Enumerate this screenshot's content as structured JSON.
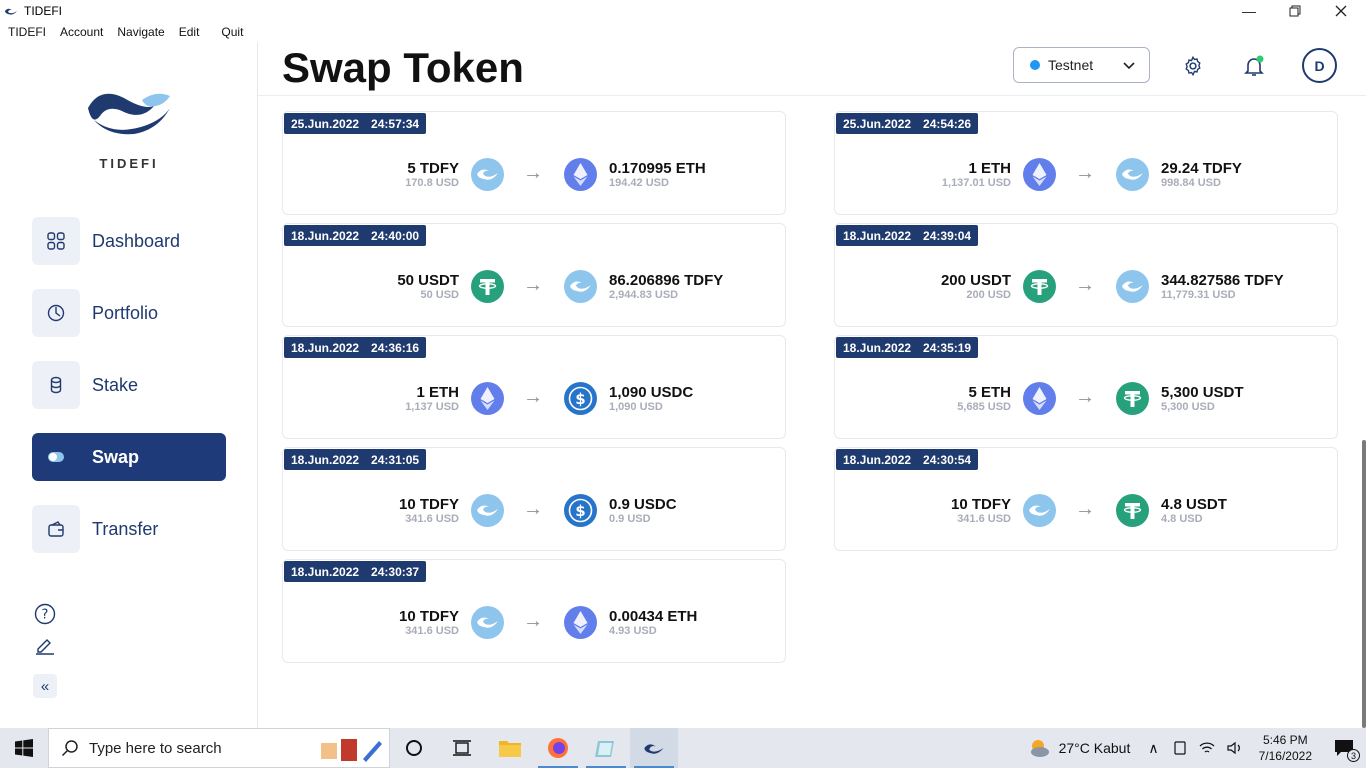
{
  "window": {
    "title": "TIDEFI"
  },
  "menu": [
    "TIDEFI",
    "Account",
    "Navigate",
    "Edit",
    "Quit"
  ],
  "brand": {
    "name": "TIDEFI"
  },
  "nav": [
    {
      "label": "Dashboard",
      "icon": "grid-icon"
    },
    {
      "label": "Portfolio",
      "icon": "pie-chart-icon"
    },
    {
      "label": "Stake",
      "icon": "coins-icon"
    },
    {
      "label": "Swap",
      "icon": "toggle-icon",
      "active": true
    },
    {
      "label": "Transfer",
      "icon": "wallet-icon"
    }
  ],
  "header": {
    "title": "Swap Token",
    "network": "Testnet",
    "avatar_initial": "D"
  },
  "swaps": [
    {
      "date": "25.Jun.2022",
      "time": "24:57:34",
      "from_amount": "5 TDFY",
      "from_usd": "170.8 USD",
      "from_token": "tdfy",
      "to_amount": "0.170995 ETH",
      "to_usd": "194.42 USD",
      "to_token": "eth"
    },
    {
      "date": "25.Jun.2022",
      "time": "24:54:26",
      "from_amount": "1 ETH",
      "from_usd": "1,137.01 USD",
      "from_token": "eth",
      "to_amount": "29.24 TDFY",
      "to_usd": "998.84 USD",
      "to_token": "tdfy"
    },
    {
      "date": "18.Jun.2022",
      "time": "24:40:00",
      "from_amount": "50 USDT",
      "from_usd": "50 USD",
      "from_token": "usdt",
      "to_amount": "86.206896 TDFY",
      "to_usd": "2,944.83 USD",
      "to_token": "tdfy"
    },
    {
      "date": "18.Jun.2022",
      "time": "24:39:04",
      "from_amount": "200 USDT",
      "from_usd": "200 USD",
      "from_token": "usdt",
      "to_amount": "344.827586 TDFY",
      "to_usd": "11,779.31 USD",
      "to_token": "tdfy"
    },
    {
      "date": "18.Jun.2022",
      "time": "24:36:16",
      "from_amount": "1 ETH",
      "from_usd": "1,137 USD",
      "from_token": "eth",
      "to_amount": "1,090 USDC",
      "to_usd": "1,090 USD",
      "to_token": "usdc"
    },
    {
      "date": "18.Jun.2022",
      "time": "24:35:19",
      "from_amount": "5 ETH",
      "from_usd": "5,685 USD",
      "from_token": "eth",
      "to_amount": "5,300 USDT",
      "to_usd": "5,300 USD",
      "to_token": "usdt"
    },
    {
      "date": "18.Jun.2022",
      "time": "24:31:05",
      "from_amount": "10 TDFY",
      "from_usd": "341.6 USD",
      "from_token": "tdfy",
      "to_amount": "0.9 USDC",
      "to_usd": "0.9 USD",
      "to_token": "usdc"
    },
    {
      "date": "18.Jun.2022",
      "time": "24:30:54",
      "from_amount": "10 TDFY",
      "from_usd": "341.6 USD",
      "from_token": "tdfy",
      "to_amount": "4.8 USDT",
      "to_usd": "4.8 USD",
      "to_token": "usdt"
    },
    {
      "date": "18.Jun.2022",
      "time": "24:30:37",
      "from_amount": "10 TDFY",
      "from_usd": "341.6 USD",
      "from_token": "tdfy",
      "to_amount": "0.00434 ETH",
      "to_usd": "4.93 USD",
      "to_token": "eth"
    }
  ],
  "taskbar": {
    "search_placeholder": "Type here to search",
    "weather": "27°C  Kabut",
    "time": "5:46 PM",
    "date": "7/16/2022",
    "notifications": "3"
  },
  "colors": {
    "primary": "#1f3a6e",
    "tdfy": "#8ec5ec",
    "eth": "#627eea",
    "usdt": "#26a17b",
    "usdc": "#2775ca"
  }
}
